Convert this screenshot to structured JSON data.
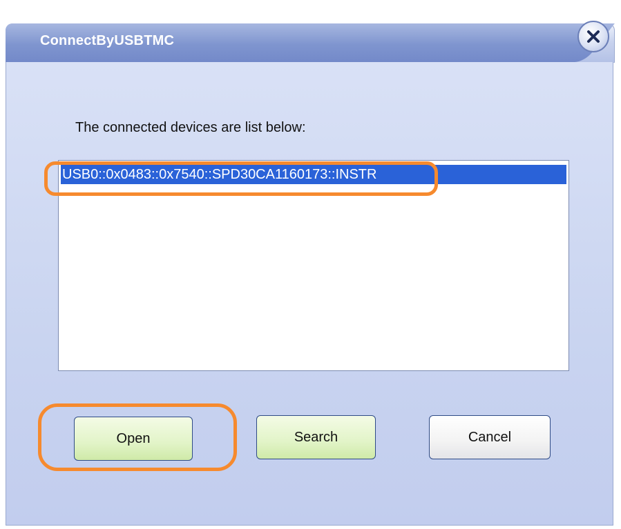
{
  "window": {
    "title": "ConnectByUSBTMC"
  },
  "dialog": {
    "instruction": "The connected devices are list below:",
    "devices": [
      {
        "label": "USB0::0x0483::0x7540::SPD30CA1160173::INSTR",
        "selected": true
      }
    ]
  },
  "buttons": {
    "open_label": "Open",
    "search_label": "Search",
    "cancel_label": "Cancel"
  },
  "colors": {
    "selection": "#2a62d8",
    "highlight_annotation": "#f68a2e",
    "button_green": "#e2f4c8"
  }
}
